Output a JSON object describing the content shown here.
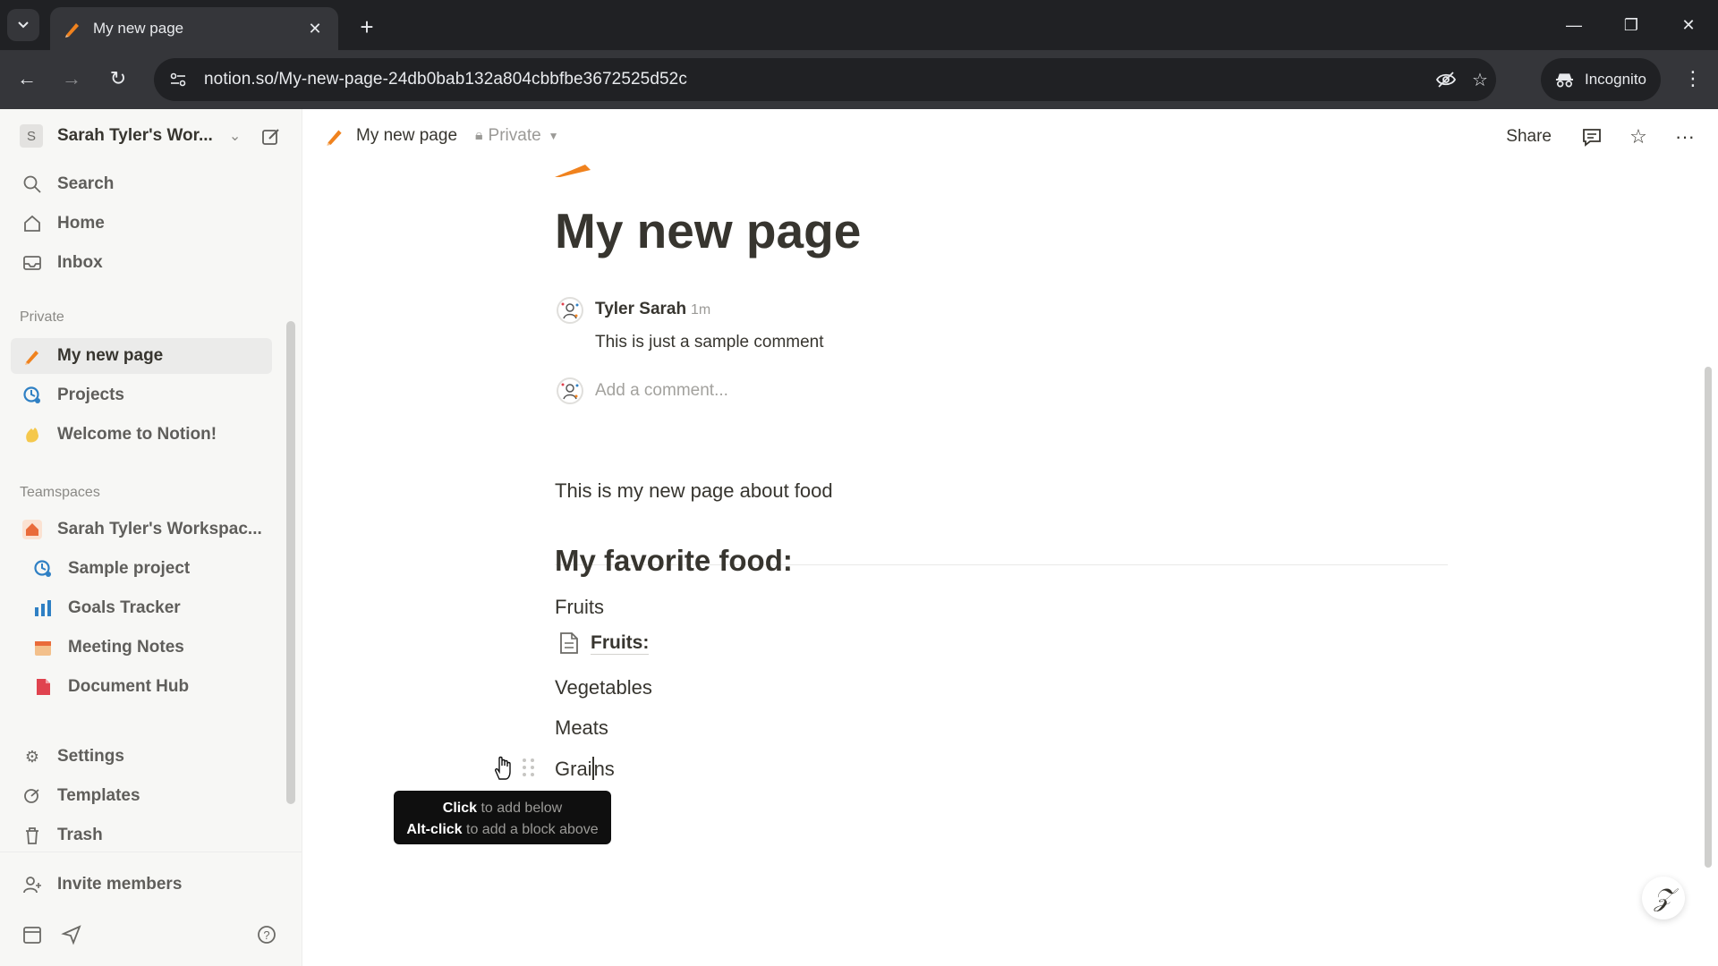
{
  "browser": {
    "tab_title": "My new page",
    "url": "notion.so/My-new-page-24db0bab132a804cbbfbe3672525d52c",
    "incognito_label": "Incognito"
  },
  "sidebar": {
    "workspace_initial": "S",
    "workspace_name": "Sarah Tyler's Wor...",
    "top_items": [
      {
        "label": "Search",
        "icon": "search-icon"
      },
      {
        "label": "Home",
        "icon": "home-icon"
      },
      {
        "label": "Inbox",
        "icon": "inbox-icon"
      }
    ],
    "private_label": "Private",
    "private_items": [
      {
        "label": "My new page",
        "icon": "pencil-emoji-icon"
      },
      {
        "label": "Projects",
        "icon": "projects-icon"
      },
      {
        "label": "Welcome to Notion!",
        "icon": "wave-emoji-icon"
      }
    ],
    "teamspaces_label": "Teamspaces",
    "teamspace_name": "Sarah Tyler's Workspac...",
    "teamspace_items": [
      {
        "label": "Sample project",
        "icon": "projects-icon"
      },
      {
        "label": "Goals Tracker",
        "icon": "goals-icon"
      },
      {
        "label": "Meeting Notes",
        "icon": "calendar-icon"
      },
      {
        "label": "Document Hub",
        "icon": "document-icon"
      }
    ],
    "bottom_items": [
      {
        "label": "Settings",
        "icon": "gear-icon"
      },
      {
        "label": "Templates",
        "icon": "templates-icon"
      },
      {
        "label": "Trash",
        "icon": "trash-icon"
      }
    ],
    "invite_label": "Invite members"
  },
  "topbar": {
    "page_title": "My new page",
    "privacy": "Private",
    "share_label": "Share"
  },
  "page": {
    "title": "My new page",
    "comment": {
      "author": "Tyler Sarah",
      "time": "1m",
      "text": "This is just a sample comment",
      "add_placeholder": "Add a comment..."
    },
    "intro": "This is my new page about food",
    "heading": "My favorite food:",
    "blocks": {
      "fruits_text": "Fruits",
      "fruits_page": "Fruits:",
      "vegetables": "Vegetables",
      "meats": "Meats",
      "grains_before_caret": "Grai",
      "grains_after_caret": "ns"
    }
  },
  "tooltip": {
    "line1_key": "Click",
    "line1_rest": "to add below",
    "line2_key": "Alt-click",
    "line2_rest": "to add a block above"
  },
  "colors": {
    "accent_orange": "#f0821e",
    "sidebar_bg": "#f7f7f5",
    "text": "#37352f"
  }
}
